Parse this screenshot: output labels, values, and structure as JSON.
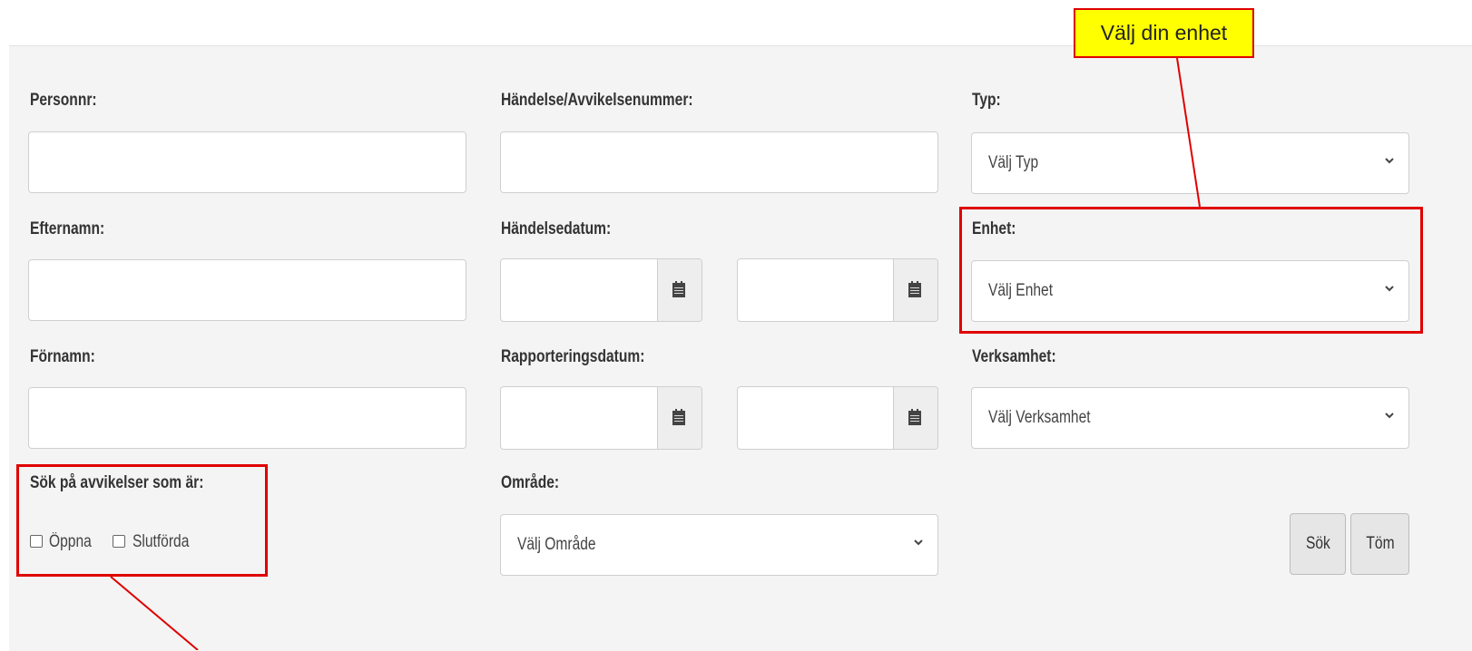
{
  "callout": {
    "text": "Välj din enhet"
  },
  "form": {
    "personnr": {
      "label": "Personnr:",
      "value": ""
    },
    "efternamn": {
      "label": "Efternamn:",
      "value": ""
    },
    "fornamn": {
      "label": "Förnamn:",
      "value": ""
    },
    "handelsenummer": {
      "label": "Händelse/Avvikelsenummer:",
      "value": ""
    },
    "handelsedatum": {
      "label": "Händelsedatum:",
      "from": "",
      "to": ""
    },
    "rapporteringsdatum": {
      "label": "Rapporteringsdatum:",
      "from": "",
      "to": ""
    },
    "omrade": {
      "label": "Område:",
      "selected": "Välj Område"
    },
    "typ": {
      "label": "Typ:",
      "selected": "Välj Typ"
    },
    "enhet": {
      "label": "Enhet:",
      "selected": "Välj Enhet"
    },
    "verksamhet": {
      "label": "Verksamhet:",
      "selected": "Välj Verksamhet"
    },
    "status": {
      "label": "Sök på avvikelser som är:",
      "options": [
        {
          "label": "Öppna",
          "checked": false
        },
        {
          "label": "Slutförda",
          "checked": false
        }
      ]
    }
  },
  "buttons": {
    "search": "Sök",
    "clear": "Töm"
  },
  "colors": {
    "annotation": "#e00000",
    "callout_bg": "#ffff00",
    "panel_bg": "#f4f4f4"
  },
  "icons": {
    "date_picker": "calendar-icon",
    "select": "chevron-down-icon"
  }
}
